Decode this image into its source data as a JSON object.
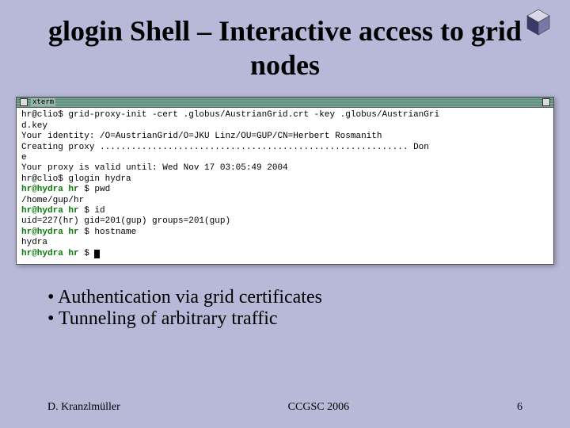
{
  "logo_name": "cube-logo",
  "title": "glogin Shell – Interactive access to grid nodes",
  "terminal": {
    "title": "xterm",
    "lines": [
      {
        "segs": [
          {
            "c": "",
            "t": "hr@clio$ grid-proxy-init -cert .globus/AustrianGrid.crt -key .globus/AustrianGri"
          }
        ]
      },
      {
        "segs": [
          {
            "c": "",
            "t": "d.key"
          }
        ]
      },
      {
        "segs": [
          {
            "c": "",
            "t": "Your identity: /O=AustrianGrid/O=JKU Linz/OU=GUP/CN=Herbert Rosmanith"
          }
        ]
      },
      {
        "segs": [
          {
            "c": "",
            "t": "Creating proxy ........................................................... Don"
          }
        ]
      },
      {
        "segs": [
          {
            "c": "",
            "t": "e"
          }
        ]
      },
      {
        "segs": [
          {
            "c": "",
            "t": "Your proxy is valid until: Wed Nov 17 03:05:49 2004"
          }
        ]
      },
      {
        "segs": [
          {
            "c": "",
            "t": "hr@clio$ glogin hydra"
          }
        ]
      },
      {
        "segs": [
          {
            "c": "p2",
            "t": "hr@hydra"
          },
          {
            "c": "",
            "t": " "
          },
          {
            "c": "hr",
            "t": "hr"
          },
          {
            "c": "",
            "t": " $ pwd"
          }
        ]
      },
      {
        "segs": [
          {
            "c": "",
            "t": "/home/gup/hr"
          }
        ]
      },
      {
        "segs": [
          {
            "c": "p2",
            "t": "hr@hydra"
          },
          {
            "c": "",
            "t": " "
          },
          {
            "c": "hr",
            "t": "hr"
          },
          {
            "c": "",
            "t": " $ id"
          }
        ]
      },
      {
        "segs": [
          {
            "c": "",
            "t": "uid=227(hr) gid=201(gup) groups=201(gup)"
          }
        ]
      },
      {
        "segs": [
          {
            "c": "p2",
            "t": "hr@hydra"
          },
          {
            "c": "",
            "t": " "
          },
          {
            "c": "hr",
            "t": "hr"
          },
          {
            "c": "",
            "t": " $ hostname"
          }
        ]
      },
      {
        "segs": [
          {
            "c": "",
            "t": "hydra"
          }
        ]
      },
      {
        "segs": [
          {
            "c": "p2",
            "t": "hr@hydra"
          },
          {
            "c": "",
            "t": " "
          },
          {
            "c": "hr",
            "t": "hr"
          },
          {
            "c": "",
            "t": " $ "
          }
        ],
        "cursor": true
      }
    ]
  },
  "bullets": [
    "Authentication via grid certificates",
    "Tunneling of arbitrary traffic"
  ],
  "footer": {
    "author": "D. Kranzlmüller",
    "venue": "CCGSC 2006",
    "page": "6"
  }
}
